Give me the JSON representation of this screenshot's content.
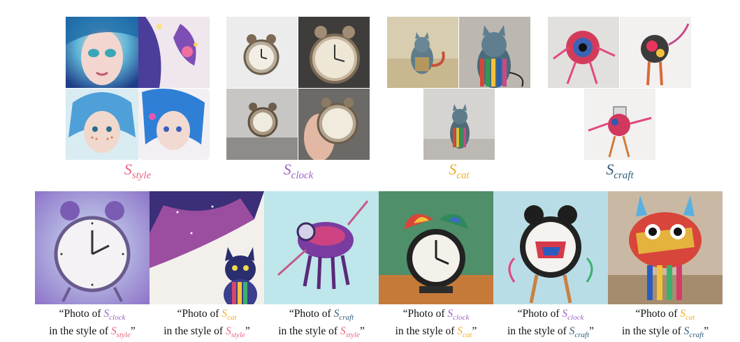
{
  "concepts": {
    "style": {
      "symbol": "S",
      "subscript": "style",
      "color": "#e8647c"
    },
    "clock": {
      "symbol": "S",
      "subscript": "clock",
      "color": "#9b62c6"
    },
    "cat": {
      "symbol": "S",
      "subscript": "cat",
      "color": "#f0ac2a"
    },
    "craft": {
      "symbol": "S",
      "subscript": "craft",
      "color": "#2f5c7a"
    }
  },
  "captions": [
    {
      "line1_prefix": "“Photo of ",
      "subject": "clock",
      "line2_prefix": "in the style of ",
      "style": "style",
      "close": "”"
    },
    {
      "line1_prefix": "“Photo of ",
      "subject": "cat",
      "line2_prefix": "in the style of ",
      "style": "style",
      "close": "”"
    },
    {
      "line1_prefix": "“Photo of ",
      "subject": "craft",
      "line2_prefix": "in the style of ",
      "style": "style",
      "close": "”"
    },
    {
      "line1_prefix": "“Photo of ",
      "subject": "clock",
      "line2_prefix": "in the style of ",
      "style": "cat",
      "close": "”"
    },
    {
      "line1_prefix": "“Photo of ",
      "subject": "clock",
      "line2_prefix": "in the style of ",
      "style": "craft",
      "close": "”"
    },
    {
      "line1_prefix": "“Photo of ",
      "subject": "cat",
      "line2_prefix": "in the style of ",
      "style": "craft",
      "close": "”"
    }
  ]
}
